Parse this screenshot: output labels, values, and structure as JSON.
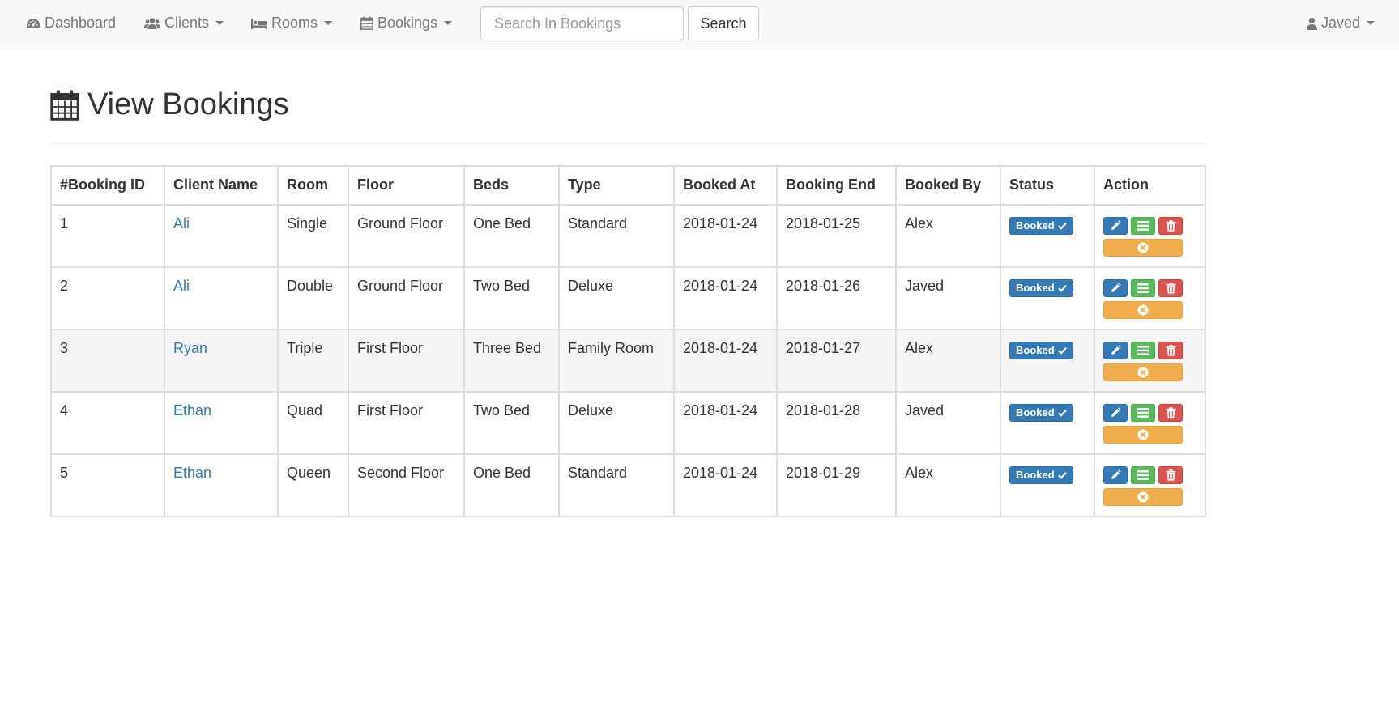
{
  "nav": {
    "dashboard": "Dashboard",
    "clients": "Clients",
    "rooms": "Rooms",
    "bookings": "Bookings",
    "search_placeholder": "Search In Bookings",
    "search_button": "Search",
    "user": "Javed"
  },
  "page": {
    "title": "View Bookings"
  },
  "table": {
    "headers": [
      "#Booking ID",
      "Client Name",
      "Room",
      "Floor",
      "Beds",
      "Type",
      "Booked At",
      "Booking End",
      "Booked By",
      "Status",
      "Action"
    ],
    "rows": [
      {
        "id": "1",
        "client": "Ali",
        "room": "Single",
        "floor": "Ground Floor",
        "beds": "One Bed",
        "type": "Standard",
        "booked_at": "2018-01-24",
        "booking_end": "2018-01-25",
        "booked_by": "Alex",
        "status": "Booked"
      },
      {
        "id": "2",
        "client": "Ali",
        "room": "Double",
        "floor": "Ground Floor",
        "beds": "Two Bed",
        "type": "Deluxe",
        "booked_at": "2018-01-24",
        "booking_end": "2018-01-26",
        "booked_by": "Javed",
        "status": "Booked"
      },
      {
        "id": "3",
        "client": "Ryan",
        "room": "Triple",
        "floor": "First Floor",
        "beds": "Three Bed",
        "type": "Family Room",
        "booked_at": "2018-01-24",
        "booking_end": "2018-01-27",
        "booked_by": "Alex",
        "status": "Booked"
      },
      {
        "id": "4",
        "client": "Ethan",
        "room": "Quad",
        "floor": "First Floor",
        "beds": "Two Bed",
        "type": "Deluxe",
        "booked_at": "2018-01-24",
        "booking_end": "2018-01-28",
        "booked_by": "Javed",
        "status": "Booked"
      },
      {
        "id": "5",
        "client": "Ethan",
        "room": "Queen",
        "floor": "Second Floor",
        "beds": "One Bed",
        "type": "Standard",
        "booked_at": "2018-01-24",
        "booking_end": "2018-01-29",
        "booked_by": "Alex",
        "status": "Booked"
      }
    ]
  },
  "icons": {
    "dashboard": "dashboard-icon",
    "clients": "users-icon",
    "rooms": "bed-icon",
    "bookings": "calendar-icon",
    "user": "user-icon",
    "status": "check-icon",
    "edit": "pencil-icon",
    "details": "list-icon",
    "delete": "trash-icon",
    "cancel": "times-circle-icon"
  },
  "colors": {
    "primary": "#337ab7",
    "success": "#5cb85c",
    "danger": "#d9534f",
    "warning": "#f0ad4e",
    "navbar_bg": "#f8f8f8"
  }
}
